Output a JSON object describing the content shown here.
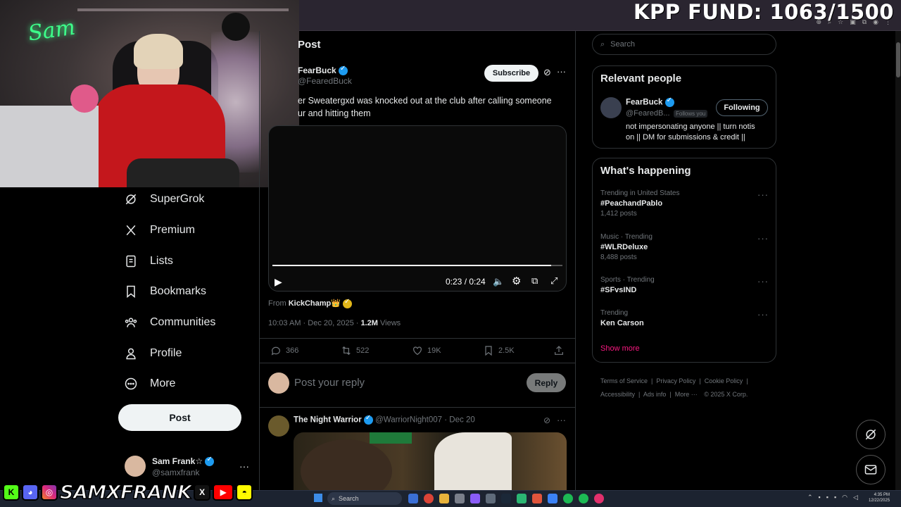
{
  "overlay": {
    "fund_text": "KPP FUND: 1063/1500",
    "neon_sign": "Sam",
    "handle": "SAMXFRANK"
  },
  "sidebar": {
    "items": [
      {
        "label": "SuperGrok",
        "icon": "grok-icon"
      },
      {
        "label": "Premium",
        "icon": "x-logo-icon"
      },
      {
        "label": "Lists",
        "icon": "list-icon"
      },
      {
        "label": "Bookmarks",
        "icon": "bookmark-icon"
      },
      {
        "label": "Communities",
        "icon": "communities-icon"
      },
      {
        "label": "Profile",
        "icon": "person-icon"
      },
      {
        "label": "More",
        "icon": "more-circle-icon"
      }
    ],
    "post_label": "Post",
    "account": {
      "name": "Sam Frank☆",
      "handle": "@samxfrank"
    }
  },
  "main": {
    "header_title": "Post",
    "tweet": {
      "author_name": "FearBuck",
      "author_handle": "@FearedBuck",
      "subscribe_label": "Subscribe",
      "text_line1": "er Sweatergxd was knocked out at the club after calling someone",
      "text_line2": "ur and hitting them",
      "video_time": "0:23 / 0:24",
      "video_progress": 0.96,
      "from_label": "From",
      "from_source": "KickChamp👑",
      "timestamp": "10:03 AM · Dec 20, 2025 ·",
      "views_count": "1.2M",
      "views_label": "Views",
      "replies": "366",
      "reposts": "522",
      "likes": "19K",
      "bookmarks": "2.5K"
    },
    "reply_placeholder": "Post your reply",
    "reply_button": "Reply",
    "reply_tweet": {
      "author_name": "The Night Warrior",
      "author_handle": "@WarriorNight007",
      "date": "· Dec 20"
    }
  },
  "right": {
    "search_placeholder": "Search",
    "relevant_title": "Relevant people",
    "person": {
      "name": "FearBuck",
      "handle": "@FearedB...",
      "follows_you": "Follows you",
      "following_label": "Following",
      "bio_line1": "not impersonating anyone || turn notis",
      "bio_line2": "on || DM for submissions & credit ||"
    },
    "happening_title": "What's happening",
    "trends": [
      {
        "category": "Trending in United States",
        "name": "#PeachandPablo",
        "count": "1,412 posts"
      },
      {
        "category": "Music · Trending",
        "name": "#WLRDeluxe",
        "count": "8,488 posts"
      },
      {
        "category": "Sports · Trending",
        "name": "#SFvsIND",
        "count": ""
      },
      {
        "category": "Trending",
        "name": "Ken Carson",
        "count": ""
      }
    ],
    "show_more": "Show more",
    "footer": {
      "terms": "Terms of Service",
      "privacy": "Privacy Policy",
      "cookie": "Cookie Policy",
      "accessibility": "Accessibility",
      "ads": "Ads info",
      "more": "More ···",
      "copyright": "© 2025 X Corp."
    }
  },
  "taskbar": {
    "search_label": "Search",
    "time": "4:35 PM",
    "date": "12/22/2025"
  },
  "colors": {
    "accent": "#1d9bf0",
    "show_more": "#f91880",
    "neon": "#3dff8a"
  }
}
